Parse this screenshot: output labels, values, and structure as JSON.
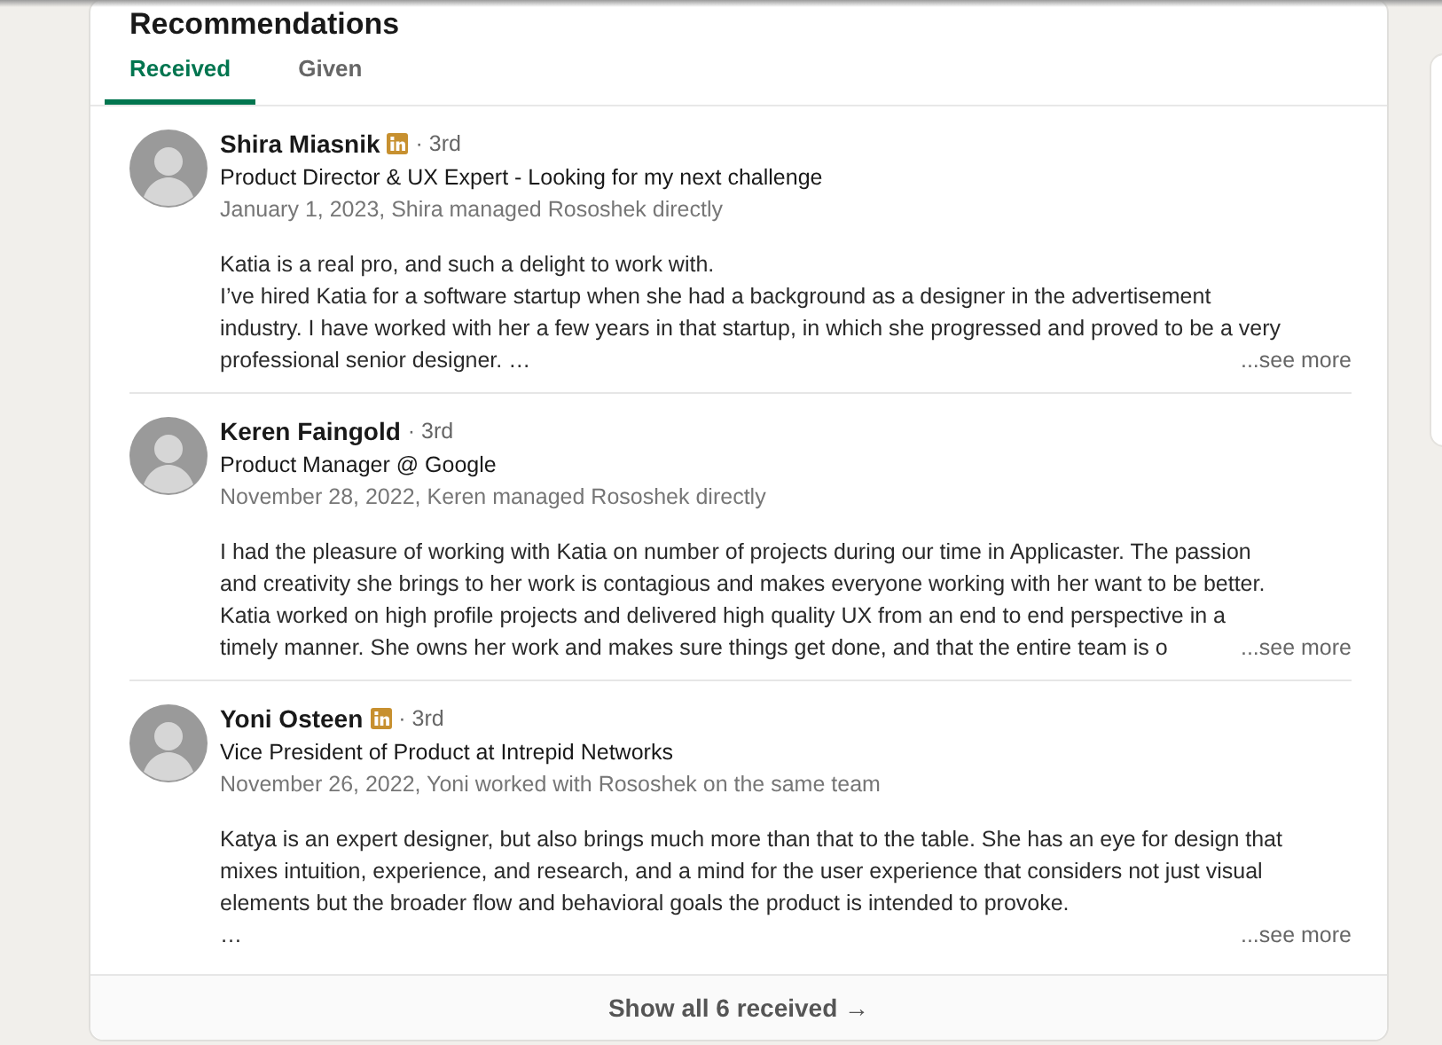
{
  "heading": "Recommendations",
  "tabs": [
    {
      "label": "Received",
      "selected": true
    },
    {
      "label": "Given",
      "selected": false
    }
  ],
  "recommendations": [
    {
      "name": "Shira Miasnik",
      "badge": true,
      "degree": "· 3rd",
      "headline": "Product Director & UX Expert - Looking for my next challenge",
      "meta": "January 1, 2023, Shira managed Rososhek directly",
      "body": "Katia is a real pro, and such a delight to work with.\nI’ve hired Katia for a software startup when she had a background as a designer in the advertisement\nindustry. I have worked with her a few years in that startup, in which she progressed and proved to be a very\nprofessional senior designer. …",
      "see_more": "...see more"
    },
    {
      "name": "Keren Faingold",
      "badge": false,
      "degree": "· 3rd",
      "headline": "Product Manager @ Google",
      "meta": "November 28, 2022, Keren managed Rososhek directly",
      "body": "I had the pleasure of working with Katia on number of projects during our time in Applicaster. The passion\nand creativity she brings to her work is contagious and makes everyone working with her want to be better.\nKatia worked on high profile projects and delivered high quality UX from an end to end perspective in a\ntimely manner. She owns her work and makes sure things get done, and that the entire team is o",
      "see_more": "...see more"
    },
    {
      "name": "Yoni Osteen",
      "badge": true,
      "degree": "· 3rd",
      "headline": "Vice President of Product at Intrepid Networks",
      "meta": "November 26, 2022, Yoni worked with Rososhek on the same team",
      "body": "Katya is an expert designer, but also brings much more than that to the table. She has an eye for design that\nmixes intuition, experience, and research, and a mind for the user experience that considers not just visual\nelements but the broader flow and behavioral goals the product is intended to provoke.\n…",
      "see_more": "...see more"
    }
  ],
  "footer": "Show all 6 received →"
}
